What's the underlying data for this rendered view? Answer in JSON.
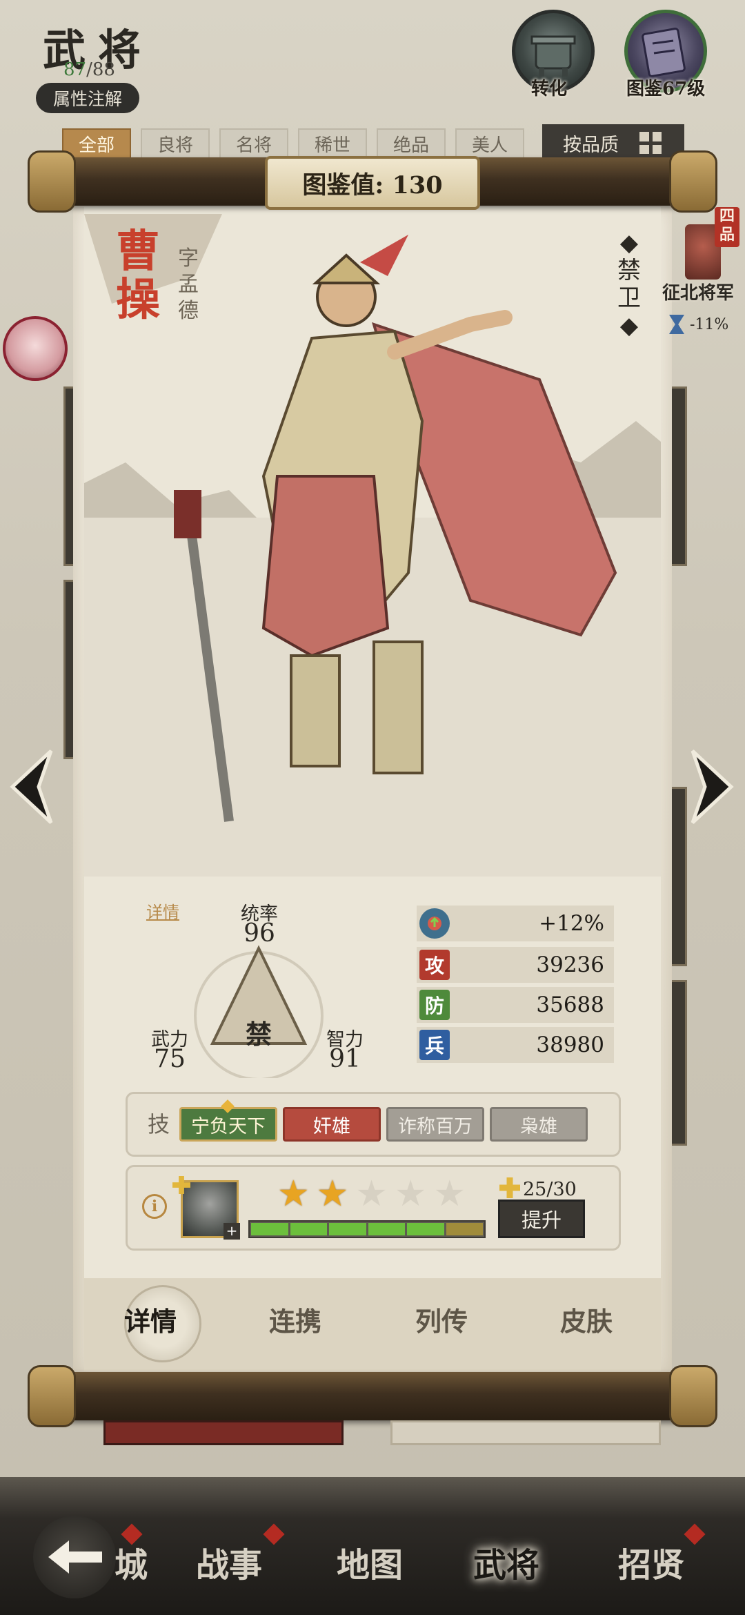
{
  "header": {
    "title": "武将",
    "owned": "87",
    "total": "/88",
    "attr_button": "属性注解",
    "convert_label": "转化",
    "codex_label": "图鉴67级"
  },
  "filters": {
    "items": [
      "全部",
      "良将",
      "名将",
      "稀世",
      "绝品",
      "美人"
    ],
    "active_index": 0,
    "sort_label": "按品质"
  },
  "scroll": {
    "codex_value": "图鉴值: 130"
  },
  "general": {
    "name_chars": [
      "曹",
      "操"
    ],
    "courtesy_chars": [
      "字",
      "孟",
      "德"
    ],
    "unit_type_chars": [
      "禁",
      "卫"
    ]
  },
  "title_widget": {
    "grade_chars": [
      "四",
      "品"
    ],
    "title": "征北将军",
    "modifier": "-11%"
  },
  "stats": {
    "detail_link": "详情",
    "command_label": "统率",
    "command_value": "96",
    "force_label": "武力",
    "force_value": "75",
    "intellect_label": "智力",
    "intellect_value": "91",
    "center_char": "禁"
  },
  "attributes": [
    {
      "icon": "bonus-icon",
      "glyph": "",
      "color": "#3f6f8d",
      "value": "+12%"
    },
    {
      "icon": "attack-icon",
      "glyph": "攻",
      "color": "#b23a2d",
      "value": "39236"
    },
    {
      "icon": "defense-icon",
      "glyph": "防",
      "color": "#4e8a3b",
      "value": "35688"
    },
    {
      "icon": "troops-icon",
      "glyph": "兵",
      "color": "#2f5ea0",
      "value": "38980"
    }
  ],
  "skills": {
    "label": "技",
    "items": [
      "宁负天下",
      "奸雄",
      "诈称百万",
      "枭雄"
    ]
  },
  "upgrade": {
    "stars_filled": 2,
    "stars_total": 5,
    "progress_segments_filled": 5,
    "progress_segments_total": 6,
    "fragment_count": "25/30",
    "upgrade_label": "提升"
  },
  "scroll_tabs": [
    "详情",
    "连携",
    "列传",
    "皮肤"
  ],
  "bottom_nav": {
    "items": [
      "城",
      "战事",
      "地图",
      "武将",
      "招贤"
    ],
    "active_index": 3
  },
  "colors": {
    "accent_red": "#b42b22",
    "paper": "#ebe6d8",
    "ink": "#2b2822"
  }
}
